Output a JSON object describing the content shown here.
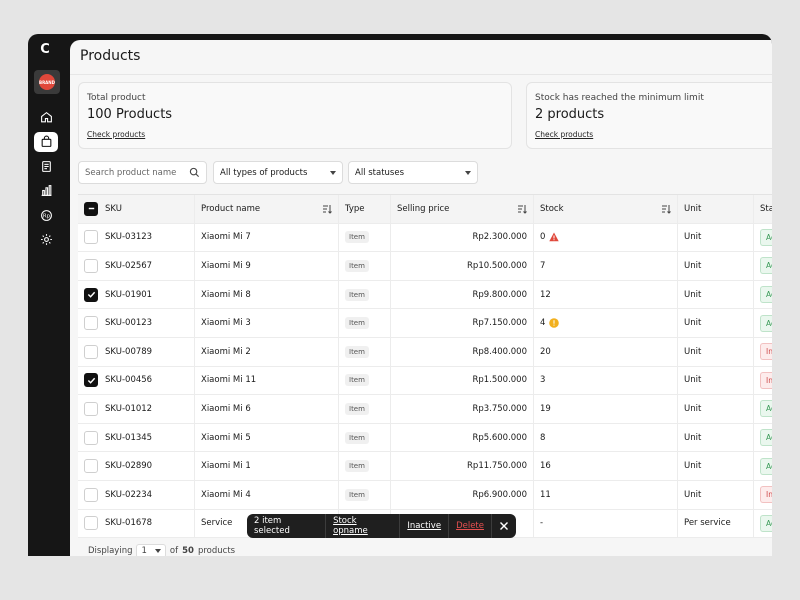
{
  "app": {
    "brand_letter": "C",
    "store_badge": "BRAND"
  },
  "nav": [
    {
      "name": "home-icon",
      "active": false
    },
    {
      "name": "bag-icon",
      "active": true
    },
    {
      "name": "document-icon",
      "active": false
    },
    {
      "name": "chart-icon",
      "active": false
    },
    {
      "name": "currency-icon",
      "active": false
    },
    {
      "name": "gear-icon",
      "active": false
    }
  ],
  "page": {
    "title": "Products"
  },
  "cards": {
    "total": {
      "label": "Total product",
      "value": "100 Products",
      "link": "Check products"
    },
    "stock": {
      "label": "Stock has reached the minimum limit",
      "value": "2 products",
      "link": "Check products"
    }
  },
  "filters": {
    "search_placeholder": "Search product name",
    "type_select": "All types of products",
    "status_select": "All statuses"
  },
  "table": {
    "columns": [
      "SKU",
      "Product name",
      "Type",
      "Selling price",
      "Stock",
      "Unit",
      "Status"
    ],
    "rows": [
      {
        "sku": "SKU-03123",
        "name": "Xiaomi Mi 7",
        "type": "Item",
        "price": "Rp2.300.000",
        "stock": "0",
        "stock_alert": "danger",
        "unit": "Unit",
        "status": "Active",
        "checked": false
      },
      {
        "sku": "SKU-02567",
        "name": "Xiaomi Mi 9",
        "type": "Item",
        "price": "Rp10.500.000",
        "stock": "7",
        "stock_alert": "",
        "unit": "Unit",
        "status": "Active",
        "checked": false
      },
      {
        "sku": "SKU-01901",
        "name": "Xiaomi Mi 8",
        "type": "Item",
        "price": "Rp9.800.000",
        "stock": "12",
        "stock_alert": "",
        "unit": "Unit",
        "status": "Active",
        "checked": true
      },
      {
        "sku": "SKU-00123",
        "name": "Xiaomi Mi 3",
        "type": "Item",
        "price": "Rp7.150.000",
        "stock": "4",
        "stock_alert": "warning",
        "unit": "Unit",
        "status": "Active",
        "checked": false
      },
      {
        "sku": "SKU-00789",
        "name": "Xiaomi Mi 2",
        "type": "Item",
        "price": "Rp8.400.000",
        "stock": "20",
        "stock_alert": "",
        "unit": "Unit",
        "status": "Inactive",
        "checked": false
      },
      {
        "sku": "SKU-00456",
        "name": "Xiaomi Mi 11",
        "type": "Item",
        "price": "Rp1.500.000",
        "stock": "3",
        "stock_alert": "",
        "unit": "Unit",
        "status": "Inactive",
        "checked": true
      },
      {
        "sku": "SKU-01012",
        "name": "Xiaomi Mi 6",
        "type": "Item",
        "price": "Rp3.750.000",
        "stock": "19",
        "stock_alert": "",
        "unit": "Unit",
        "status": "Active",
        "checked": false
      },
      {
        "sku": "SKU-01345",
        "name": "Xiaomi Mi 5",
        "type": "Item",
        "price": "Rp5.600.000",
        "stock": "8",
        "stock_alert": "",
        "unit": "Unit",
        "status": "Active",
        "checked": false
      },
      {
        "sku": "SKU-02890",
        "name": "Xiaomi Mi 1",
        "type": "Item",
        "price": "Rp11.750.000",
        "stock": "16",
        "stock_alert": "",
        "unit": "Unit",
        "status": "Active",
        "checked": false
      },
      {
        "sku": "SKU-02234",
        "name": "Xiaomi Mi 4",
        "type": "Item",
        "price": "Rp6.900.000",
        "stock": "11",
        "stock_alert": "",
        "unit": "Unit",
        "status": "Inactive",
        "checked": false
      },
      {
        "sku": "SKU-01678",
        "name": "Service",
        "type": "",
        "price": "",
        "stock": "-",
        "stock_alert": "",
        "unit": "Per service",
        "status": "Active",
        "checked": false
      }
    ]
  },
  "footer": {
    "displaying": "Displaying",
    "page": "1",
    "of": "of",
    "total": "50",
    "suffix": "products"
  },
  "bulk": {
    "selected": "2 item selected",
    "opname": "Stock opname",
    "inactive": "Inactive",
    "delete": "Delete"
  },
  "colors": {
    "active": "#3a9a57",
    "inactive": "#cc4b4b",
    "danger": "#e0483b",
    "warning": "#f2b01e"
  }
}
